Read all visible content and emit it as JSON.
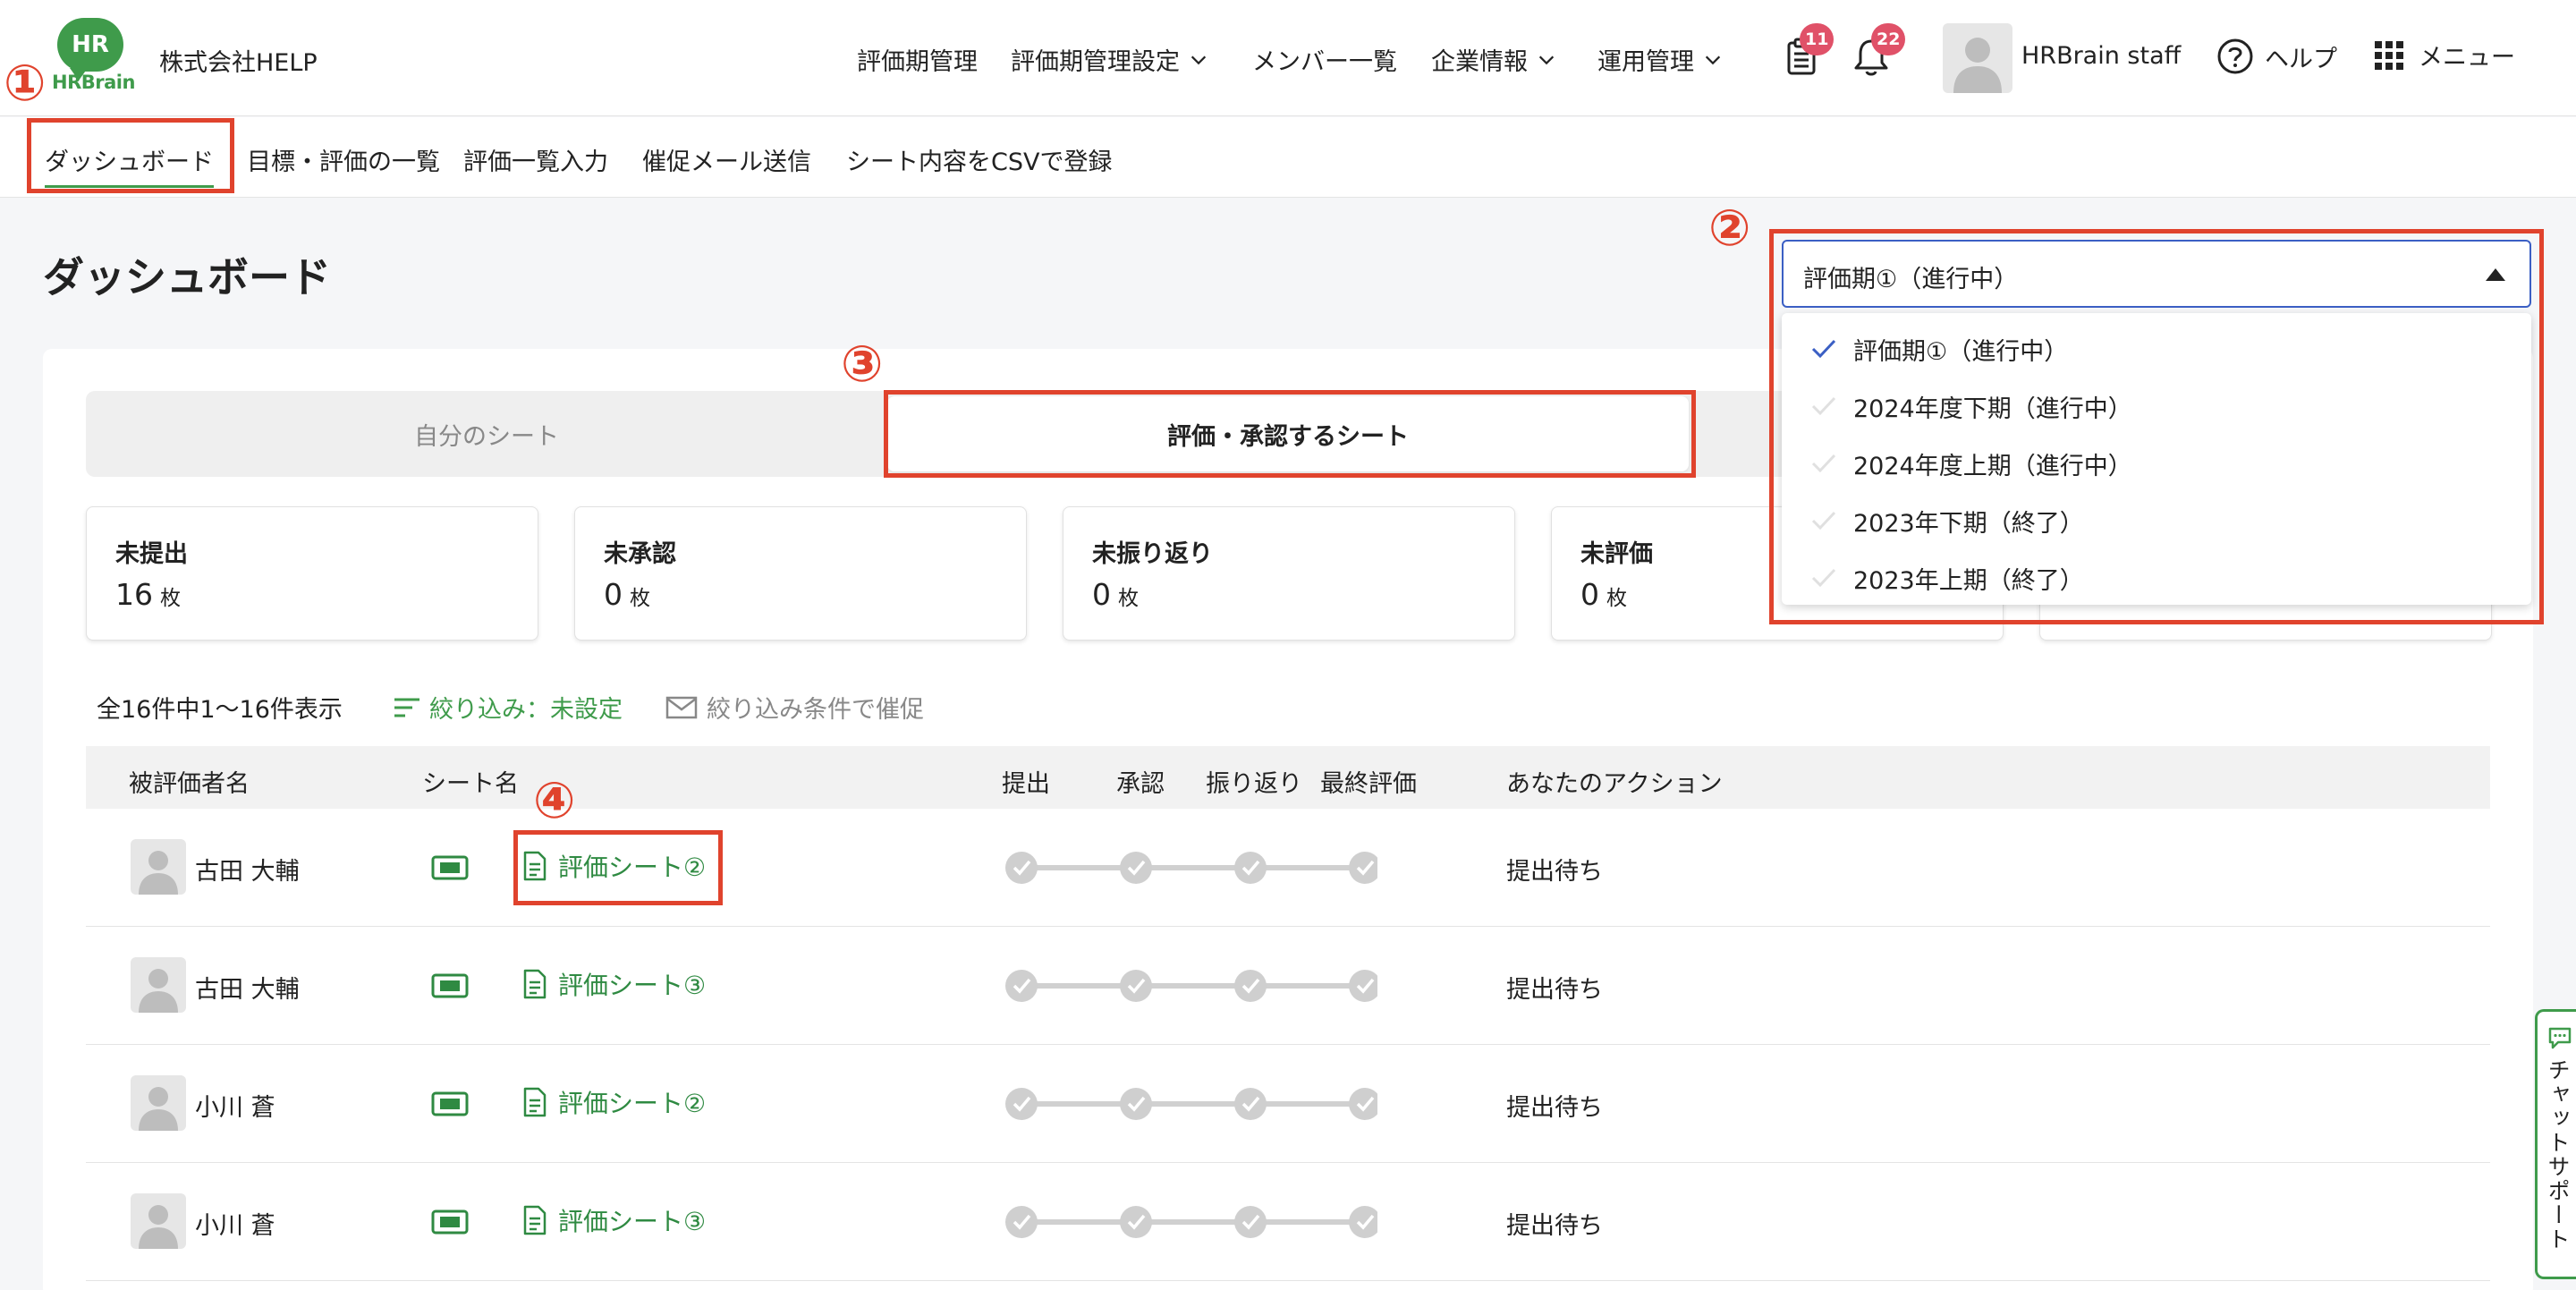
{
  "header": {
    "logo_mark": "HR",
    "logo_text": "HRBrain",
    "company": "株式会社HELP",
    "nav": [
      {
        "label": "評価期管理"
      },
      {
        "label": "評価期管理設定"
      },
      {
        "label": "メンバー一覧"
      },
      {
        "label": "企業情報"
      },
      {
        "label": "運用管理"
      }
    ],
    "task_badge": "11",
    "notification_badge": "22",
    "user_name": "HRBrain staff",
    "help_label": "ヘルプ",
    "menu_label": "メニュー"
  },
  "subnav": {
    "items": [
      {
        "label": "ダッシュボード"
      },
      {
        "label": "目標・評価の一覧"
      },
      {
        "label": "評価一覧入力"
      },
      {
        "label": "催促メール送信"
      },
      {
        "label": "シート内容をCSVで登録"
      }
    ]
  },
  "page": {
    "title": "ダッシュボード"
  },
  "tabs": {
    "own": "自分のシート",
    "review": "評価・承認するシート"
  },
  "stats": [
    {
      "label": "未提出",
      "value": "16",
      "unit": "枚"
    },
    {
      "label": "未承認",
      "value": "0",
      "unit": "枚"
    },
    {
      "label": "未振り返り",
      "value": "0",
      "unit": "枚"
    },
    {
      "label": "未評価",
      "value": "0",
      "unit": "枚"
    }
  ],
  "list": {
    "count_text": "全16件中1〜16件表示",
    "filter_label": "絞り込み：未設定",
    "remind_label": "絞り込み条件で催促"
  },
  "table": {
    "headers": [
      "被評価者名",
      "シート名",
      "提出",
      "承認",
      "振り返り",
      "最終評価",
      "あなたのアクション"
    ],
    "rows": [
      {
        "name": "古田 大輔",
        "sheet": "評価シート②",
        "action": "提出待ち"
      },
      {
        "name": "古田 大輔",
        "sheet": "評価シート③",
        "action": "提出待ち"
      },
      {
        "name": "小川 蒼",
        "sheet": "評価シート②",
        "action": "提出待ち"
      },
      {
        "name": "小川 蒼",
        "sheet": "評価シート③",
        "action": "提出待ち"
      }
    ]
  },
  "period_dropdown": {
    "selected": "評価期①（進行中）",
    "options": [
      {
        "label": "評価期①（進行中）",
        "checked": true
      },
      {
        "label": "2024年度下期（進行中）",
        "checked": false
      },
      {
        "label": "2024年度上期（進行中）",
        "checked": false
      },
      {
        "label": "2023年下期（終了）",
        "checked": false
      },
      {
        "label": "2023年上期（終了）",
        "checked": false
      }
    ]
  },
  "annotations": [
    "①",
    "②",
    "③",
    "④"
  ],
  "chat_support": "チャットサポート",
  "colors": {
    "brand_green": "#3f9b4b",
    "link_green": "#2f8a42",
    "annotation_red": "#e0432d",
    "select_border_blue": "#3b5fc4",
    "badge_red": "#e05168"
  }
}
